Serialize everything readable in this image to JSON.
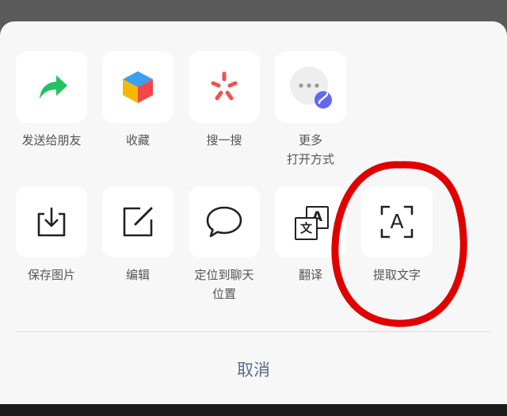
{
  "row1": [
    {
      "icon": "share-arrow-icon",
      "label": "发送给朋友"
    },
    {
      "icon": "cube-icon",
      "label": "收藏"
    },
    {
      "icon": "search-star-icon",
      "label": "搜一搜"
    },
    {
      "icon": "more-miniprogram-icon",
      "label": "更多\n打开方式"
    }
  ],
  "row2": [
    {
      "icon": "download-image-icon",
      "label": "保存图片"
    },
    {
      "icon": "edit-icon",
      "label": "编辑"
    },
    {
      "icon": "speech-bubble-icon",
      "label": "定位到聊天\n位置"
    },
    {
      "icon": "translate-icon",
      "label": "翻译"
    },
    {
      "icon": "extract-text-icon",
      "label": "提取文字"
    }
  ],
  "translate_glyphs": {
    "back": "A",
    "front": "文"
  },
  "extract_glyph": "A",
  "cancel_label": "取消",
  "colors": {
    "accent": "#576b95",
    "share": "#22c35e",
    "annotation": "#e00000"
  }
}
